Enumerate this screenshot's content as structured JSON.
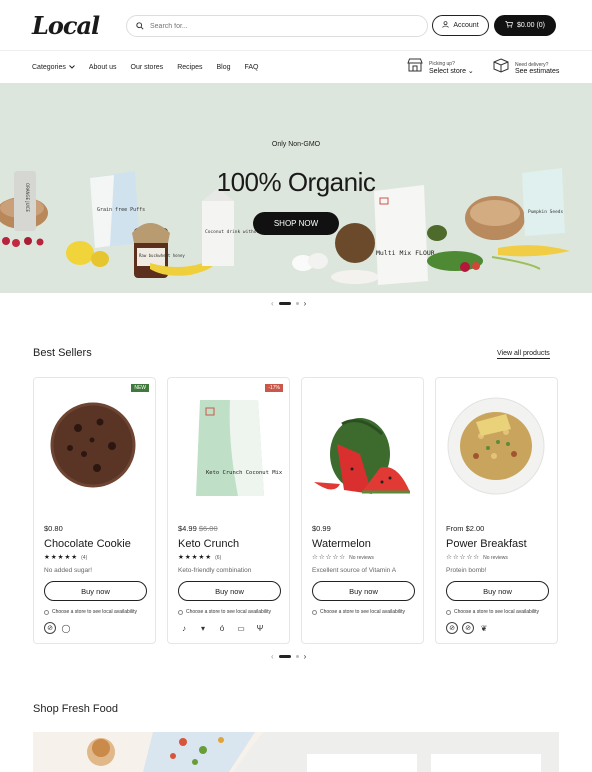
{
  "header": {
    "logo": "Local",
    "search_placeholder": "Search for...",
    "account_label": "Account",
    "cart_label": "$0.00 (0)"
  },
  "nav": {
    "items": [
      "Categories",
      "About us",
      "Our stores",
      "Recipes",
      "Blog",
      "FAQ"
    ],
    "pickup": {
      "small": "Picking up?",
      "big": "Select store"
    },
    "delivery": {
      "small": "Need delivery?",
      "big": "See estimates"
    }
  },
  "hero": {
    "subtitle": "Only Non-GMO",
    "title": "100% Organic",
    "cta": "SHOP NOW",
    "background": "#dde6dc",
    "pack_labels": {
      "juice": "ORANGE JUICE",
      "puffs": "Grain free Puffs",
      "jar": "Raw buckwheat honey",
      "coconut": "Coconut drink without sugar",
      "flour": "Multi Mix FLOUR",
      "pumpkin": "Pumpkin Seeds"
    }
  },
  "best_sellers": {
    "title": "Best Sellers",
    "view_all": "View all products",
    "availability": "Choose a store to see local availability",
    "products": [
      {
        "price": "$0.80",
        "old_price": "",
        "name": "Chocolate Cookie",
        "stars": "★★★★★",
        "reviews": "(4)",
        "desc": "No added sugar!",
        "buy": "Buy now",
        "badge": "NEW",
        "badge_color": "#3f7a3c"
      },
      {
        "price": "$4.99",
        "old_price": "$6.00",
        "name": "Keto Crunch",
        "stars": "★★★★★",
        "reviews": "(6)",
        "desc": "Keto-friendly combination",
        "buy": "Buy now",
        "badge": "-17%",
        "badge_color": "#c9574a",
        "pack_label": "Keto Crunch Coconut Mix"
      },
      {
        "price": "$0.99",
        "old_price": "",
        "name": "Watermelon",
        "stars": "☆☆☆☆☆",
        "reviews": "No reviews",
        "desc": "Excellent source of Vitamin A",
        "buy": "Buy now",
        "badge": "",
        "badge_color": ""
      },
      {
        "price": "From $2.00",
        "old_price": "",
        "name": "Power Breakfast",
        "stars": "☆☆☆☆☆",
        "reviews": "No reviews",
        "desc": "Protein bomb!",
        "buy": "Buy now",
        "badge": "",
        "badge_color": ""
      }
    ]
  },
  "fresh_food": {
    "title": "Shop Fresh Food"
  },
  "colors": {
    "accent": "#111111",
    "hero_bg": "#dde6dc",
    "new_badge": "#3f7a3c",
    "sale_badge": "#c9574a"
  }
}
